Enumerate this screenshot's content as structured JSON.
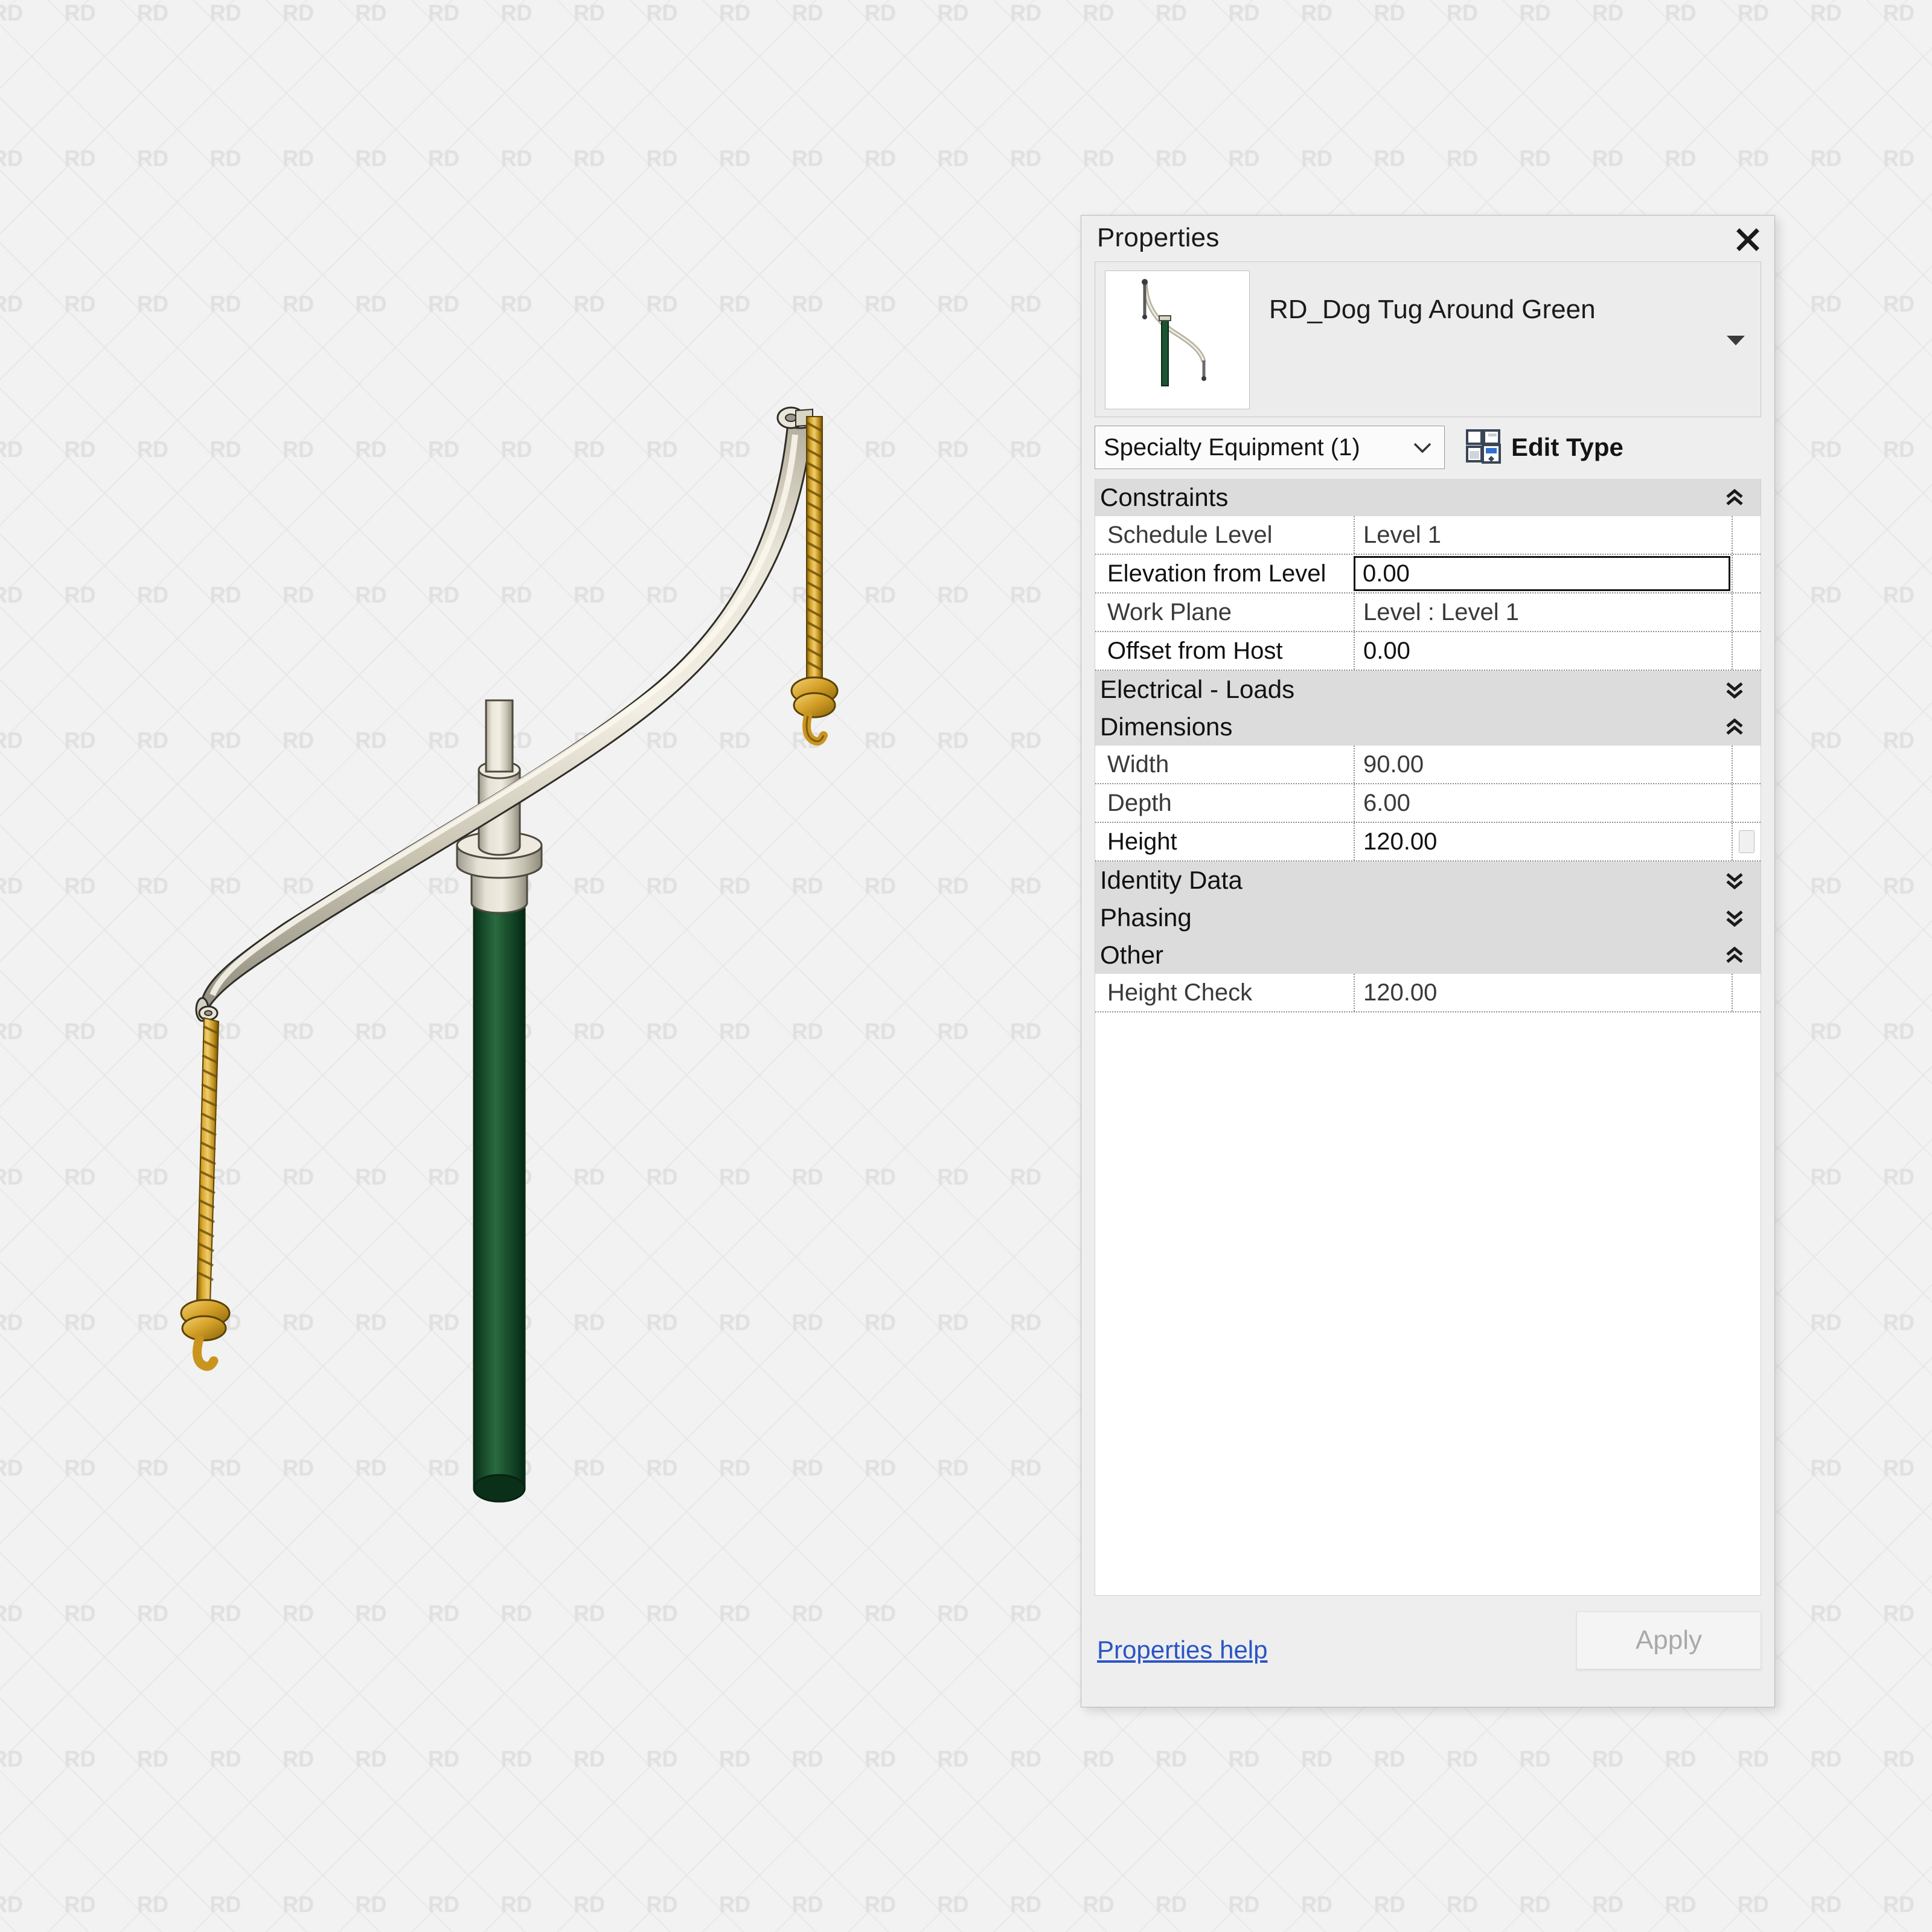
{
  "palette": {
    "title": "Properties",
    "close_icon": "close-icon",
    "type_name": "RD_Dog Tug Around Green",
    "type_name_line1": "RD_Dog Tug Around",
    "type_name_line2": "Green",
    "type_caret_icon": "caret-down-icon",
    "category_select": {
      "value": "Specialty Equipment (1)",
      "chevron_icon": "chevron-down-icon"
    },
    "edit_type": {
      "label": "Edit Type",
      "icon": "edit-type-icon"
    },
    "groups": [
      {
        "name": "Constraints",
        "state_icon": "double-chevron-up-icon",
        "rows": [
          {
            "name": "Schedule Level",
            "value": "Level 1",
            "editable": false,
            "focused": false,
            "has_button": false
          },
          {
            "name": "Elevation from Level",
            "value": "0.00",
            "editable": true,
            "focused": true,
            "has_button": false
          },
          {
            "name": "Work Plane",
            "value": "Level : Level 1",
            "editable": false,
            "focused": false,
            "has_button": false
          },
          {
            "name": "Offset from Host",
            "value": "0.00",
            "editable": true,
            "focused": false,
            "has_button": false
          }
        ]
      },
      {
        "name": "Electrical - Loads",
        "state_icon": "double-chevron-down-icon",
        "rows": []
      },
      {
        "name": "Dimensions",
        "state_icon": "double-chevron-up-icon",
        "rows": [
          {
            "name": "Width",
            "value": "90.00",
            "editable": false,
            "focused": false,
            "has_button": false
          },
          {
            "name": "Depth",
            "value": "6.00",
            "editable": false,
            "focused": false,
            "has_button": false
          },
          {
            "name": "Height",
            "value": "120.00",
            "editable": true,
            "focused": false,
            "has_button": true
          }
        ]
      },
      {
        "name": "Identity Data",
        "state_icon": "double-chevron-down-icon",
        "rows": []
      },
      {
        "name": "Phasing",
        "state_icon": "double-chevron-down-icon",
        "rows": []
      },
      {
        "name": "Other",
        "state_icon": "double-chevron-up-icon",
        "rows": [
          {
            "name": "Height Check",
            "value": "120.00",
            "editable": false,
            "focused": false,
            "has_button": false
          }
        ]
      }
    ],
    "footer": {
      "help_link": "Properties help",
      "apply_label": "Apply"
    }
  },
  "viewport": {
    "background_watermark_text": "RD",
    "model_name": "RD_Dog Tug Around Green",
    "colors": {
      "arm_light": "#ded9c8",
      "arm_mid": "#bdb8a6",
      "arm_dark": "#8e8a7c",
      "post_green_dark": "#0c3a1e",
      "post_green_light": "#2f7044",
      "rope_gold": "#c9951f",
      "rope_gold_light": "#e8c05a",
      "rope_dark": "#6b4e08",
      "collar_light": "#e4e0d4",
      "collar_dark": "#a9a596",
      "outline": "#202020"
    }
  },
  "theme": {
    "page_background": "#f2f2f2",
    "watermark_color": "#e2e2e2",
    "panel_background": "#eeeeee",
    "group_header_background": "#dcdcdc",
    "link_color": "#2b55c4",
    "accent_blue": "#2f6fd0"
  }
}
